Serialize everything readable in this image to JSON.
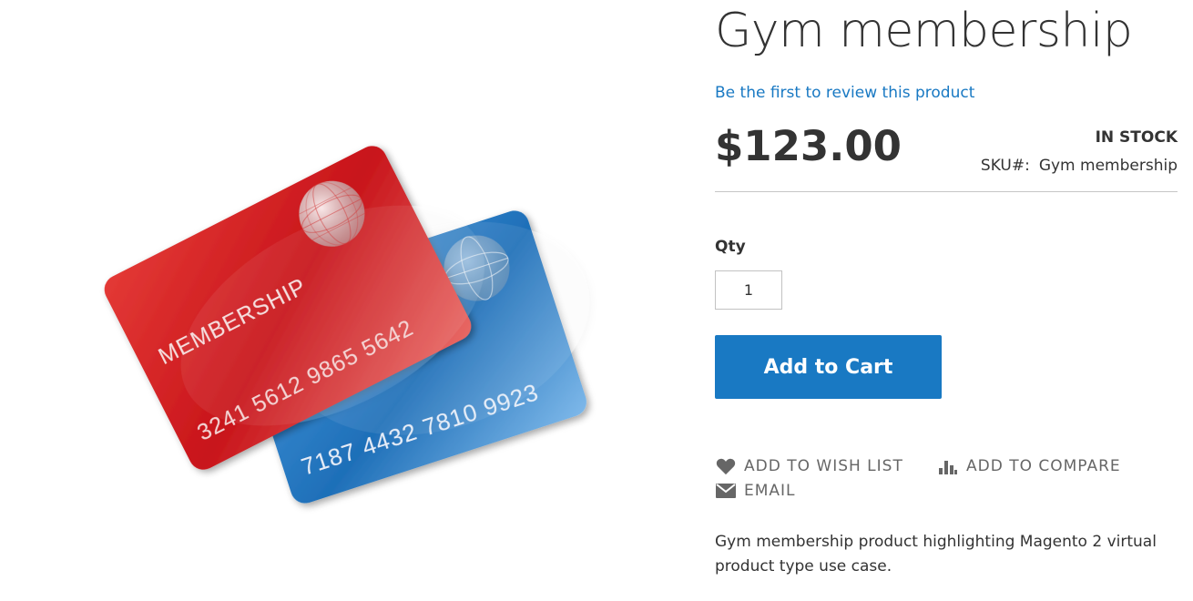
{
  "product": {
    "title": "Gym membership",
    "review_link": "Be the first to review this product",
    "price": "$123.00",
    "stock": "IN STOCK",
    "sku_label": "SKU#:",
    "sku_value": "Gym membership",
    "qty_label": "Qty",
    "qty_value": "1",
    "add_to_cart": "Add to Cart",
    "description": "Gym membership product highlighting Magento 2 virtual product type use case."
  },
  "image": {
    "front_card_text": "MEMBERSHIP",
    "front_card_number": "3241 5612 9865 5642",
    "back_card_number": "7187 4432 7810 9923"
  },
  "actions": {
    "wishlist": "ADD TO WISH LIST",
    "compare": "ADD TO COMPARE",
    "email": "EMAIL"
  },
  "colors": {
    "accent": "#1979c3",
    "text": "#333333",
    "muted": "#666666",
    "card_red": "#c8141a",
    "card_blue": "#1e6fb8"
  },
  "icons": {
    "wishlist": "heart-icon",
    "compare": "bar-chart-icon",
    "email": "envelope-icon"
  }
}
